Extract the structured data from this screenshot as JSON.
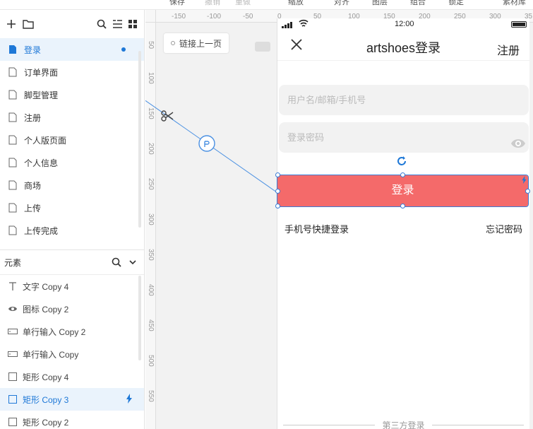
{
  "toolbar": {
    "items": [
      "保存",
      "撤销",
      "重做",
      "缩放",
      "对齐",
      "图层",
      "组合",
      "锁定",
      "素材库"
    ]
  },
  "pages": {
    "items": [
      "登录",
      "订单界面",
      "脚型管理",
      "注册",
      "个人版页面",
      "个人信息",
      "商场",
      "上传",
      "上传完成"
    ],
    "active": "登录"
  },
  "elements": {
    "header": "元素",
    "items": [
      {
        "label": "文字 Copy 4",
        "icon": "text-icon"
      },
      {
        "label": "图标 Copy 2",
        "icon": "eye-icon"
      },
      {
        "label": "单行输入 Copy 2",
        "icon": "input-icon"
      },
      {
        "label": "单行输入 Copy",
        "icon": "input-icon"
      },
      {
        "label": "矩形 Copy 4",
        "icon": "rect-icon"
      },
      {
        "label": "矩形 Copy 3",
        "icon": "rect-icon"
      },
      {
        "label": "矩形 Copy 2",
        "icon": "rect-icon"
      }
    ],
    "active": "矩形 Copy 3"
  },
  "canvas": {
    "link_label": "链接上一页",
    "ruler_h": [
      "-150",
      "-100",
      "-50",
      "0",
      "50",
      "100",
      "150",
      "200",
      "250",
      "300",
      "35"
    ],
    "ruler_v": [
      "50",
      "100",
      "150",
      "200",
      "250",
      "300",
      "350",
      "400",
      "450",
      "500",
      "550"
    ]
  },
  "phone": {
    "time": "12:00",
    "title": "artshoes登录",
    "register": "注册",
    "username_placeholder": "用户名/邮箱/手机号",
    "password_placeholder": "登录密码",
    "login_button": "登录",
    "quick_login": "手机号快捷登录",
    "forgot": "忘记密码",
    "third_party": "第三方登录"
  },
  "colors": {
    "accent": "#1e78d7",
    "login_button": "#f46a6a",
    "selection": "#3a7bd5"
  }
}
